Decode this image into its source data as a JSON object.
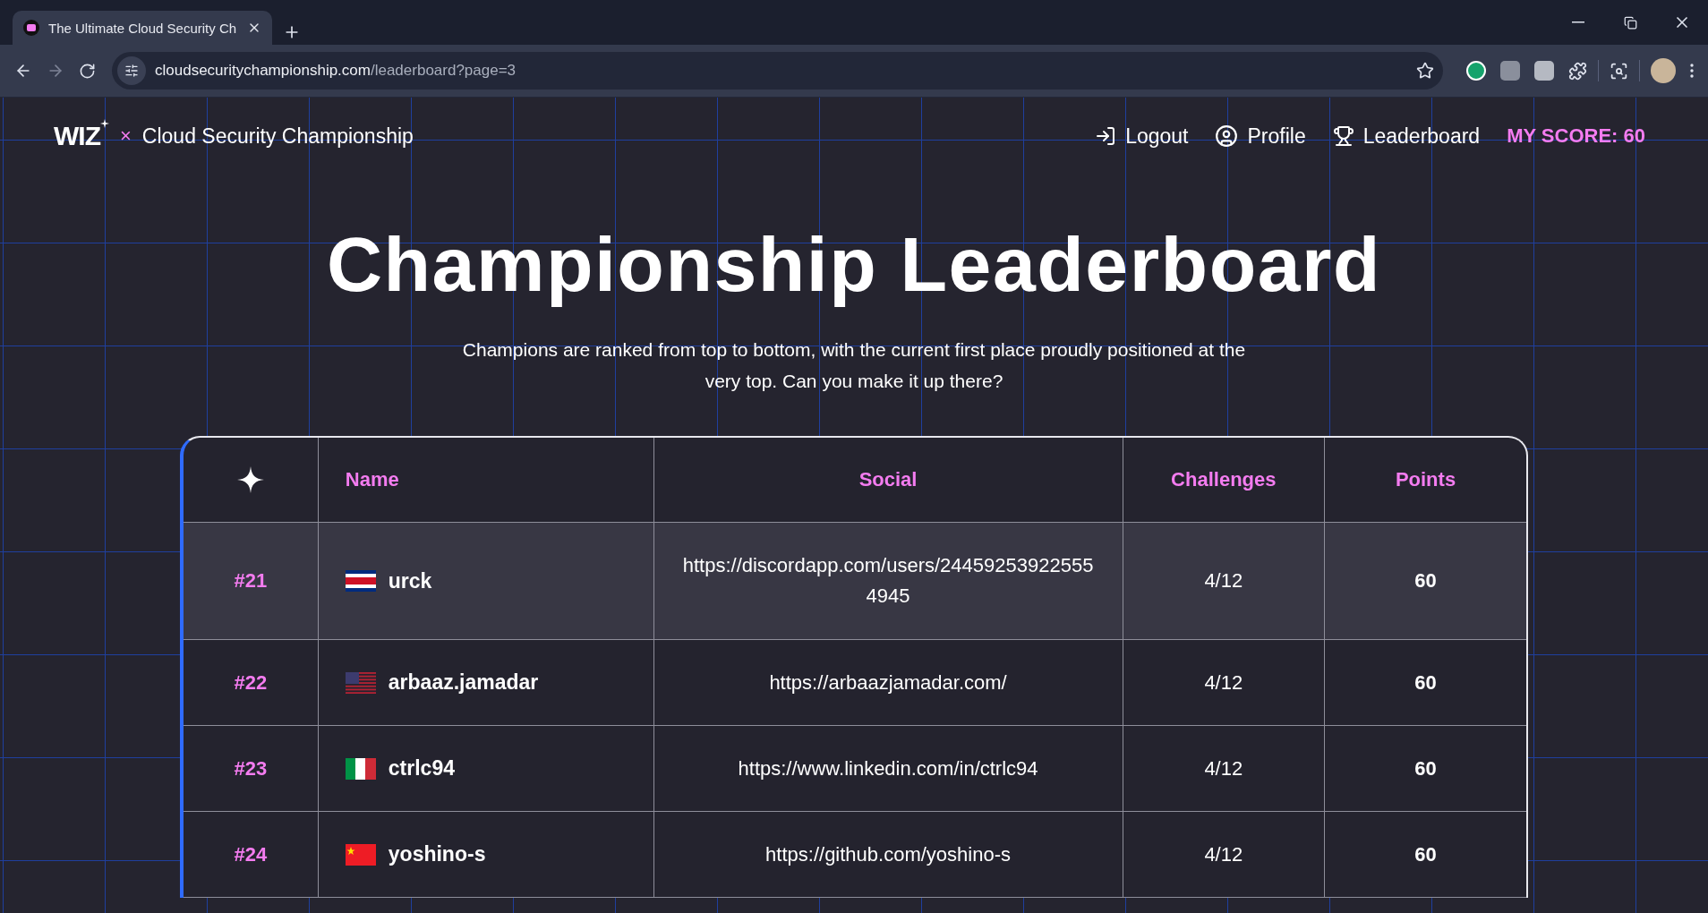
{
  "browser": {
    "tab": {
      "title": "The Ultimate Cloud Security Ch",
      "selected": true
    },
    "url": {
      "host": "cloudsecuritychampionship.com",
      "path": "/leaderboard?page=3"
    }
  },
  "header": {
    "logo": "WIZ",
    "separator": "×",
    "site_title": "Cloud Security Championship",
    "nav": [
      {
        "kind": "logout",
        "label": "Logout"
      },
      {
        "kind": "profile",
        "label": "Profile"
      },
      {
        "kind": "leaderboard",
        "label": "Leaderboard"
      }
    ],
    "score": "MY SCORE: 60"
  },
  "hero": {
    "title": "Championship Leaderboard",
    "subtitle": "Champions are ranked from top to bottom, with the current first place proudly positioned at the very top. Can you make it up there?"
  },
  "table": {
    "columns": [
      "Name",
      "Social",
      "Challenges",
      "Points"
    ],
    "rows": [
      {
        "rank": "#21",
        "kind": "cr",
        "name": "urck",
        "social": "https://discordapp.com/users/244592539225554945",
        "challenges": "4/12",
        "points": "60",
        "hovered": true
      },
      {
        "rank": "#22",
        "kind": "us",
        "name": "arbaaz.jamadar",
        "social": "https://arbaazjamadar.com/",
        "challenges": "4/12",
        "points": "60",
        "hovered": false
      },
      {
        "rank": "#23",
        "kind": "it",
        "name": "ctrlc94",
        "social": "https://www.linkedin.com/in/ctrlc94",
        "challenges": "4/12",
        "points": "60",
        "hovered": false
      },
      {
        "rank": "#24",
        "kind": "cn",
        "name": "yoshino-s",
        "social": "https://github.com/yoshino-s",
        "challenges": "4/12",
        "points": "60",
        "hovered": false
      }
    ]
  }
}
